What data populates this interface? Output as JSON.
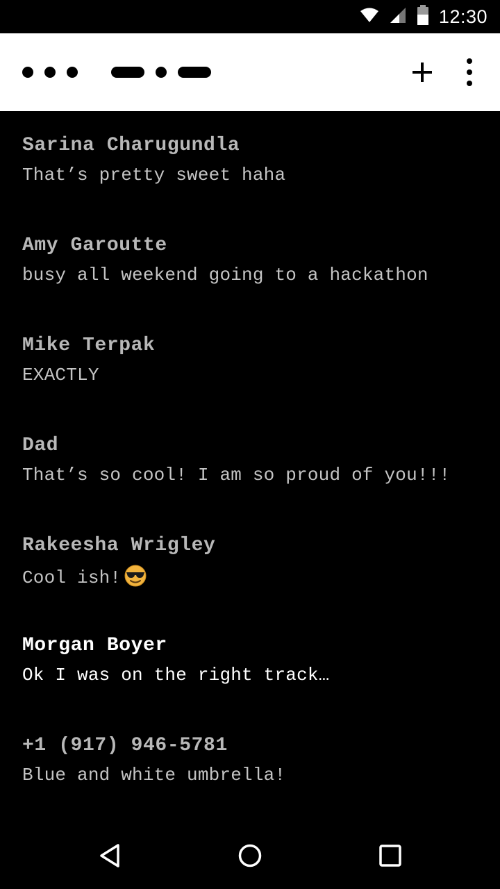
{
  "status_bar": {
    "time": "12:30",
    "icons": [
      "wifi-icon",
      "cell-signal-icon",
      "battery-icon"
    ]
  },
  "app_bar": {
    "logo_icon": "dots-and-dashes-logo",
    "actions": [
      "add-icon",
      "overflow-menu-icon"
    ],
    "background": "#ffffff"
  },
  "conversations": [
    {
      "name": "Sarina Charugundla",
      "preview": "That’s pretty sweet haha",
      "unread": false
    },
    {
      "name": "Amy Garoutte",
      "preview": "busy all weekend going to a hackathon",
      "unread": false
    },
    {
      "name": "Mike Terpak",
      "preview": "EXACTLY",
      "unread": false
    },
    {
      "name": "Dad",
      "preview": "That’s so cool! I am so proud of you!!!",
      "unread": false
    },
    {
      "name": "Rakeesha Wrigley",
      "preview": "Cool ish!",
      "preview_emoji": "smiling-face-with-sunglasses-icon",
      "unread": false
    },
    {
      "name": "Morgan Boyer",
      "preview": "Ok I was on the right track…",
      "unread": true
    },
    {
      "name": "+1 (917) 946-5781",
      "preview": "Blue and white umbrella!",
      "unread": false
    }
  ],
  "nav_bar": {
    "buttons": [
      "back-triangle-icon",
      "home-circle-icon",
      "recents-square-icon"
    ]
  },
  "colors": {
    "background": "#000000",
    "read_text": "#b8b8b8",
    "unread_text": "#ffffff"
  }
}
